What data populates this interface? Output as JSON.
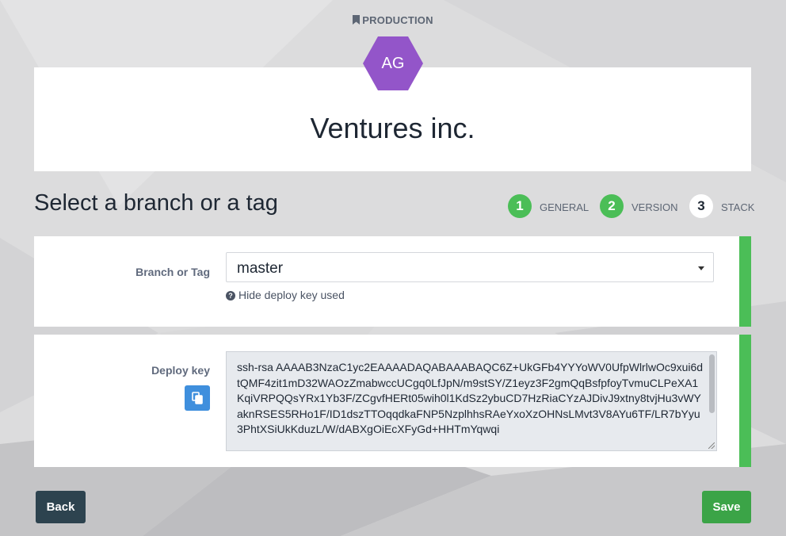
{
  "environment": {
    "label": "PRODUCTION",
    "icon": "bookmark-icon"
  },
  "avatar": {
    "initials": "AG",
    "color": "#9355c9"
  },
  "organization": {
    "name": "Ventures inc."
  },
  "section": {
    "title": "Select a branch or a tag"
  },
  "steps": [
    {
      "number": "1",
      "label": "GENERAL",
      "state": "done"
    },
    {
      "number": "2",
      "label": "VERSION",
      "state": "done"
    },
    {
      "number": "3",
      "label": "STACK",
      "state": "current"
    }
  ],
  "branch_form": {
    "label": "Branch or Tag",
    "selected": "master",
    "toggle_link": "Hide deploy key used"
  },
  "deploy_key": {
    "label": "Deploy key",
    "copy_icon": "copy-icon",
    "value": "ssh-rsa AAAAB3NzaC1yc2EAAAADAQABAAABAQC6Z+UkGFb4YYYoWV0UfpWlrlwOc9xui6dtQMF4zit1mD32WAOzZmabwccUCgq0LfJpN/m9stSY/Z1eyz3F2gmQqBsfpfoyTvmuCLPeXA1KqiVRPQQsYRx1Yb3F/ZCgvfHERt05wih0l1KdSz2ybuCD7HzRiaCYzAJDivJ9xtny8tvjHu3vWYaknRSES5RHo1F/ID1dszTTOqqdkaFNP5NzplhhsRAeYxoXzOHNsLMvt3V8AYu6TF/LR7bYyu3PhtXSiUkKduzL/W/dABXgOiEcXFyGd+HHTmYqwqi"
  },
  "actions": {
    "back": "Back",
    "save": "Save"
  },
  "colors": {
    "accent": "#4bbe57",
    "save": "#3ba447",
    "back": "#2d434f",
    "copy": "#3f8fdd"
  }
}
